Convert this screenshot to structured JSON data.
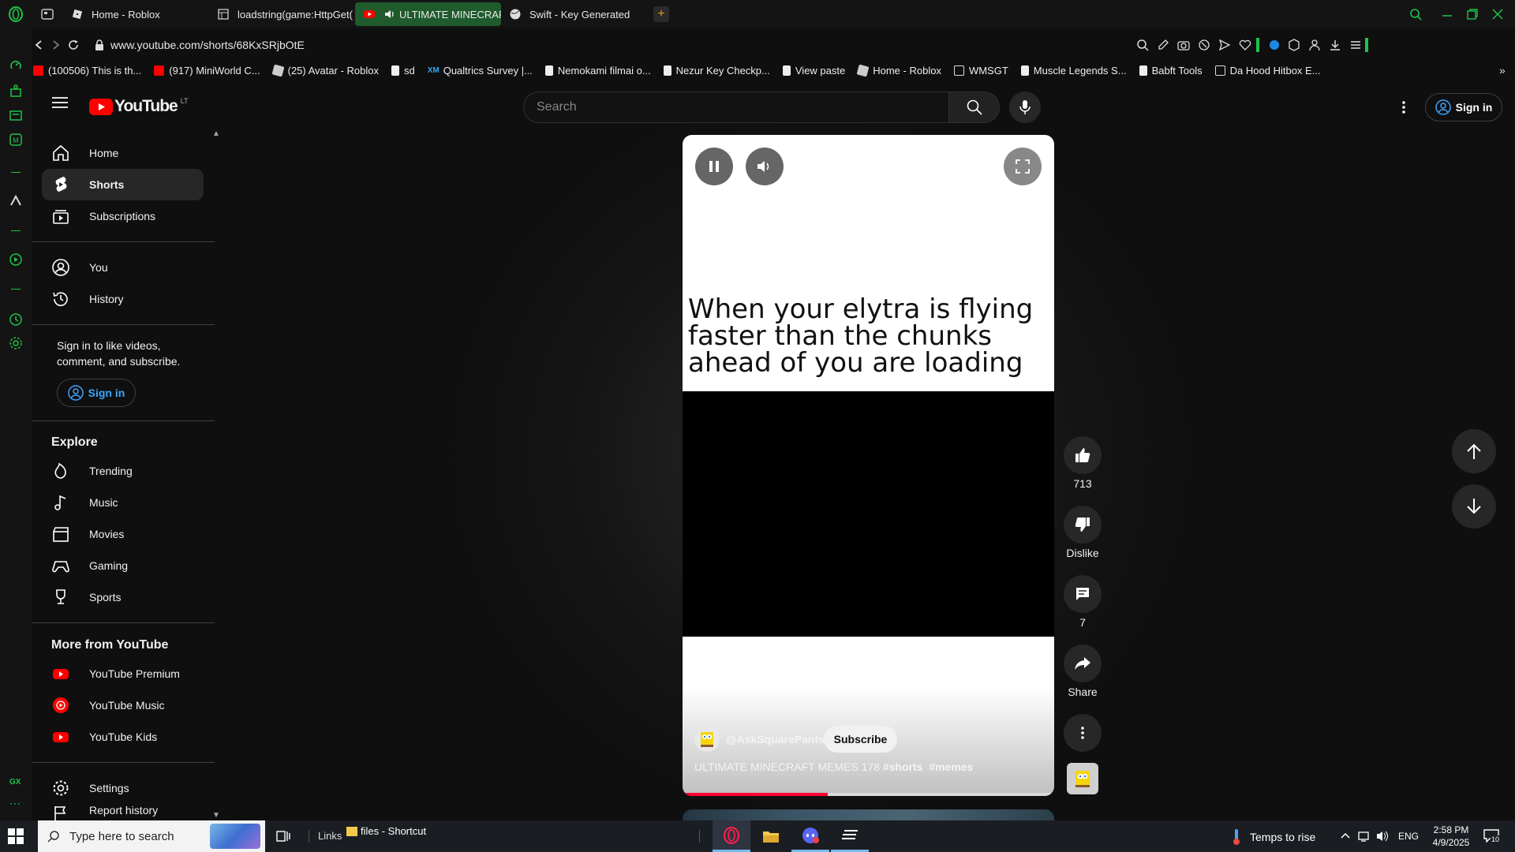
{
  "browser": {
    "tabs": [
      {
        "label": "Home - Roblox",
        "active": false
      },
      {
        "label": "loadstring(game:HttpGet(",
        "active": false
      },
      {
        "label": "ULTIMATE MINECRAF",
        "active": true
      },
      {
        "label": "Swift - Key Generated",
        "active": false
      }
    ],
    "url": "www.youtube.com/shorts/68KxSRjbOtE",
    "bookmarks": [
      "(100506) This is th...",
      "(917) MiniWorld C...",
      "(25) Avatar - Roblox",
      "sd",
      "Qualtrics Survey |...",
      "Nemokami filmai o...",
      "Nezur Key Checkp...",
      "View paste",
      "Home - Roblox",
      "WMSGT",
      "Muscle Legends S...",
      "Babft Tools",
      "Da Hood Hitbox E..."
    ],
    "bookmark_prefix_xm": "XM",
    "opera_gx_label": "GX"
  },
  "youtube": {
    "logo_text": "YouTube",
    "country": "LT",
    "search_placeholder": "Search",
    "sign_in": "Sign in",
    "nav_main": [
      "Home",
      "Shorts",
      "Subscriptions"
    ],
    "nav_you": [
      "You",
      "History"
    ],
    "signin_prompt": "Sign in to like videos, comment, and subscribe.",
    "explore_title": "Explore",
    "explore": [
      "Trending",
      "Music",
      "Movies",
      "Gaming",
      "Sports"
    ],
    "more_title": "More from YouTube",
    "more": [
      "YouTube Premium",
      "YouTube Music",
      "YouTube Kids"
    ],
    "settings": "Settings",
    "report_history": "Report history"
  },
  "short": {
    "caption": "When your elytra is flying faster than the chunks ahead of you are loading",
    "channel": "@AskSquarePants",
    "subscribe": "Subscribe",
    "title": "ULTIMATE MINECRAFT MEMES 178",
    "hashtags": [
      "#shorts",
      "#memes"
    ],
    "progress_fraction": 0.39,
    "likes": "713",
    "dislike_label": "Dislike",
    "comments": "7",
    "share_label": "Share"
  },
  "taskbar": {
    "search_placeholder": "Type here to search",
    "links_label": "Links",
    "shortcut_label": "files - Shortcut",
    "weather": "Temps to rise",
    "lang": "ENG",
    "time": "2:58 PM",
    "date": "4/9/2025",
    "notif_count": "10"
  },
  "colors": {
    "opera_accent": "#1fc24a",
    "youtube_red": "#ff0000",
    "progress_red": "#f03",
    "active_tab_bg": "#1f5b2c"
  }
}
